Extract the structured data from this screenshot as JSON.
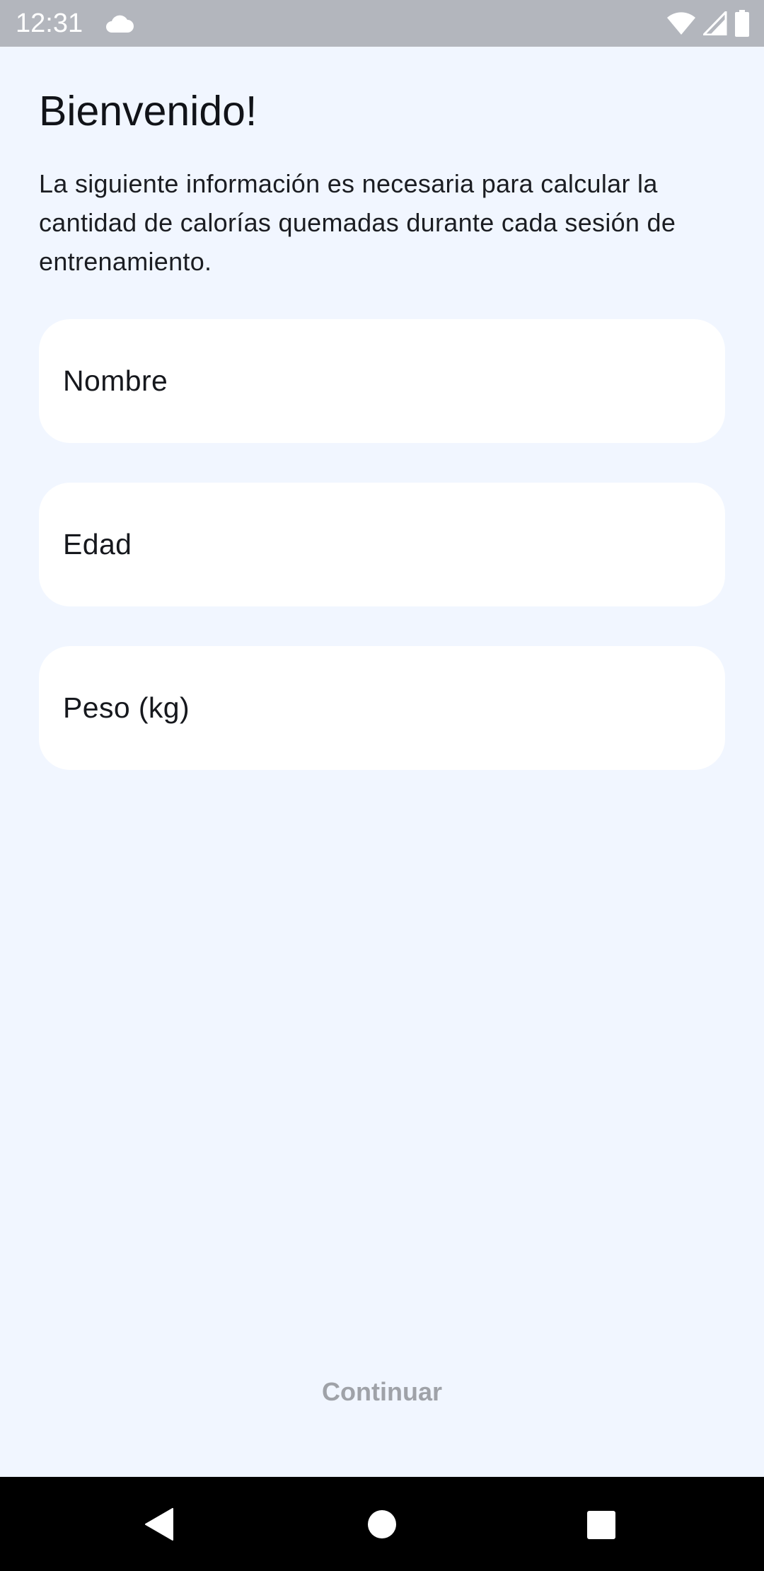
{
  "status_bar": {
    "time": "12:31",
    "icons": [
      "cloud-icon",
      "wifi-icon",
      "signal-icon",
      "battery-icon"
    ]
  },
  "header": {
    "title": "Bienvenido!",
    "description": "La siguiente información es necesaria para calcular la cantidad de calorías quemadas durante cada sesión de entrenamiento."
  },
  "form": {
    "name_label": "Nombre",
    "age_label": "Edad",
    "weight_label": "Peso (kg)"
  },
  "actions": {
    "continue_label": "Continuar"
  },
  "nav_bar": {
    "icons": [
      "back-icon",
      "home-icon",
      "recents-icon"
    ]
  },
  "colors": {
    "background": "#f1f6ff",
    "field_background": "#ffffff",
    "status_bar": "#b3b6bd",
    "disabled_text": "#9fa2a8"
  }
}
